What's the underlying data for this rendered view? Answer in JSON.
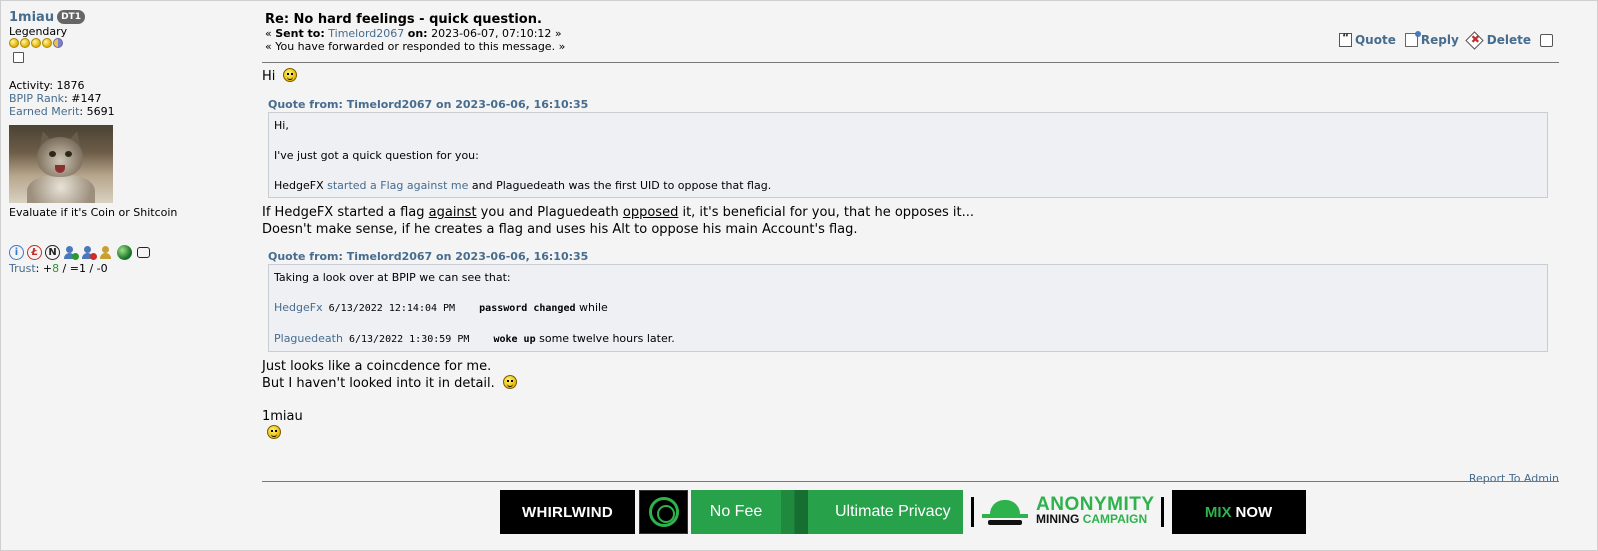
{
  "poster": {
    "name": "1miau",
    "badge": "DT1",
    "rank": "Legendary",
    "activity_label": "Activity:",
    "activity_value": "1876",
    "bpip_label": "BPIP Rank",
    "bpip_value": ": #147",
    "merit_label": "Earned Merit",
    "merit_value": ": 5691",
    "personal_text": "Evaluate if it's Coin or Shitcoin",
    "trust_label": "Trust",
    "trust_sep1": ": +",
    "trust_pos": "8",
    "trust_rest": " / =1 / -0",
    "icons": [
      "info-icon",
      "litecoin-icon",
      "n-icon",
      "add-user-icon",
      "remove-user-icon",
      "user-icon",
      "globe-icon",
      "message-icon"
    ]
  },
  "post": {
    "subject": "Re: No hard feelings - quick question.",
    "meta_prefix": "« ",
    "sent_to_label": "Sent to:",
    "sent_to": "Timelord2067",
    "on_label": "on:",
    "date": "2023-06-07, 07:10:12",
    "meta_suffix": " »",
    "forwarded": "« You have forwarded or responded to this message. »",
    "actions": {
      "quote": "Quote",
      "reply": "Reply",
      "delete": "Delete"
    },
    "greeting": "Hi",
    "quote1": {
      "header": "Quote from: Timelord2067 on 2023-06-06, 16:10:35",
      "line1": "Hi,",
      "line2": "I've just got a quick question for you:",
      "line3_a": "HedgeFX ",
      "line3_link": "started a Flag against me",
      "line3_b": " and Plaguedeath was the first UID to oppose that flag."
    },
    "para1_a": "If HedgeFX started a flag ",
    "para1_u1": "against",
    "para1_b": " you and Plaguedeath ",
    "para1_u2": "opposed",
    "para1_c": " it, it's beneficial for you, that he opposes it...",
    "para2": "Doesn't make sense, if he creates a flag and uses his Alt to oppose his main Account's flag.",
    "quote2": {
      "header": "Quote from: Timelord2067 on 2023-06-06, 16:10:35",
      "line1": "Taking a look over at BPIP we can see that:",
      "row1_user": "HedgeFx",
      "row1_time": " 6/13/2022 12:14:04 PM    ",
      "row1_event": "password changed",
      "row1_tail": " while",
      "row2_user": "Plaguedeath",
      "row2_time": " 6/13/2022 1:30:59 PM    ",
      "row2_event": "woke up",
      "row2_tail": " some twelve hours later."
    },
    "para3": "Just looks like a coincdence for me.",
    "para4": "But I haven't looked into it in detail.",
    "signature": "1miau",
    "report": "Report To Admin"
  },
  "ad": {
    "whirlwind": "WHIRLWIND",
    "no_fee": "No Fee",
    "ultimate_privacy": "Ultimate Privacy",
    "anonymity": "ANONYMITY",
    "mining": "MINING",
    "campaign": "CAMPAIGN",
    "mix": "MIX",
    "now": "NOW"
  },
  "colors": {
    "link": "#476c8e",
    "accent_green": "#2db24c",
    "trust_positive": "#2a9a2a"
  }
}
